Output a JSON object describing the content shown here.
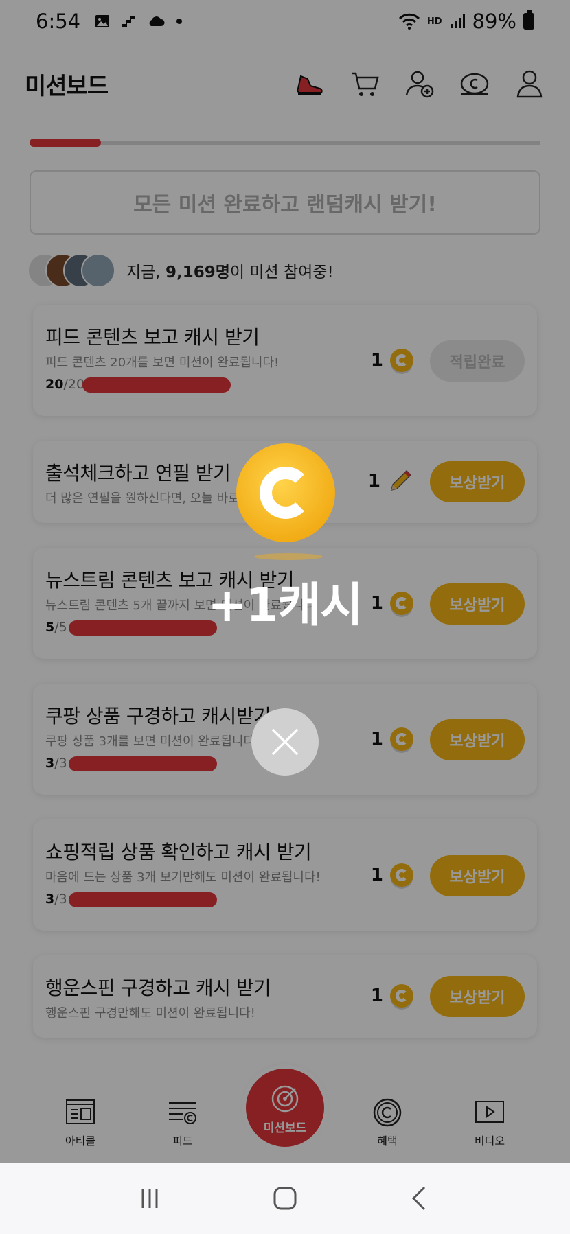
{
  "status_bar": {
    "time": "6:54",
    "battery": "89%",
    "hd_label": "HD"
  },
  "header": {
    "title": "미션보드"
  },
  "progress": {
    "fraction": 0.14
  },
  "banner": {
    "text": "모든 미션 완료하고 랜덤캐시 받기!"
  },
  "participants": {
    "prefix": "지금, ",
    "count": "9,169명",
    "suffix": "이 미션 참여중!"
  },
  "missions": [
    {
      "title": "피드 콘텐츠 보고 캐시 받기",
      "desc": "피드 콘텐츠 20개를 보면 미션이 완료됩니다!",
      "done": "20",
      "total": "/20",
      "reward": "1",
      "reward_icon": "coin-icon",
      "button": "적립완료"
    },
    {
      "title": "출석체크하고 연필 받기",
      "desc": "더 많은 연필을 원하신다면, 오늘 바로",
      "reward": "1",
      "reward_icon": "pencil-icon",
      "button": "보상받기"
    },
    {
      "title": "뉴스트림 콘텐츠 보고 캐시 받기",
      "desc": "뉴스트림 콘텐츠 5개 끝까지 보면 미션이 완료됩니다",
      "done": "5",
      "total": "/5",
      "reward": "1",
      "reward_icon": "coin-icon",
      "button": "보상받기"
    },
    {
      "title": "쿠팡 상품 구경하고 캐시받기",
      "desc": "쿠팡 상품 3개를 보면 미션이 완료됩니다",
      "done": "3",
      "total": "/3",
      "reward": "1",
      "reward_icon": "coin-icon",
      "button": "보상받기"
    },
    {
      "title": "쇼핑적립 상품 확인하고 캐시 받기",
      "desc": "마음에 드는 상품 3개 보기만해도 미션이 완료됩니다!",
      "done": "3",
      "total": "/3",
      "reward": "1",
      "reward_icon": "coin-icon",
      "button": "보상받기"
    },
    {
      "title": "행운스핀 구경하고 캐시 받기",
      "desc": "행운스핀 구경만해도 미션이 완료됩니다!",
      "reward": "1",
      "reward_icon": "coin-icon",
      "button": "보상받기"
    }
  ],
  "bottom_nav": {
    "article": "아티클",
    "feed": "피드",
    "mission": "미션보드",
    "benefit": "혜택",
    "video": "비디오"
  },
  "popup": {
    "text": "+1캐시"
  },
  "colors": {
    "accent_red": "#e2363b",
    "coin_yellow": "#f6b617"
  }
}
